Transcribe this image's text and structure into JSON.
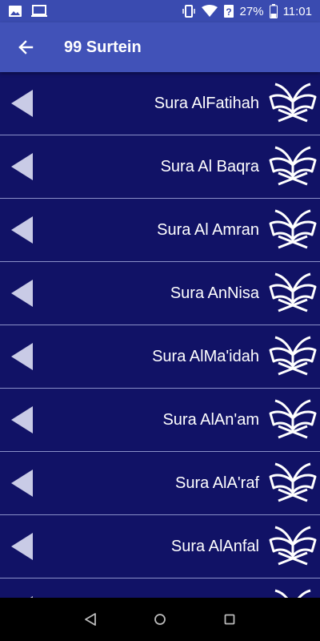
{
  "status_bar": {
    "battery_percent": "27%",
    "time": "11:01",
    "icons": [
      "image-icon",
      "laptop-icon",
      "vibrate-icon",
      "wifi-icon",
      "signal-icon",
      "battery-icon"
    ]
  },
  "app_bar": {
    "title": "99 Surtein",
    "back_icon": "arrow-left-icon"
  },
  "colors": {
    "status_bar": "#3a4bb0",
    "app_bar": "#4152b8",
    "list_background": "#111266",
    "divider": "#8a90c8",
    "nav_bar": "#000000"
  },
  "suras": [
    {
      "label": "Sura AlFatihah"
    },
    {
      "label": "Sura Al Baqra"
    },
    {
      "label": "Sura Al Amran"
    },
    {
      "label": "Sura AnNisa"
    },
    {
      "label": "Sura AlMa'idah"
    },
    {
      "label": "Sura AlAn'am"
    },
    {
      "label": "Sura AlA'raf"
    },
    {
      "label": "Sura AlAnfal"
    },
    {
      "label": ""
    }
  ],
  "row_icons": {
    "left": "play-left-icon",
    "right": "quran-book-icon"
  },
  "nav_bar": {
    "icons": [
      "back-triangle-icon",
      "home-circle-icon",
      "recents-square-icon"
    ]
  }
}
